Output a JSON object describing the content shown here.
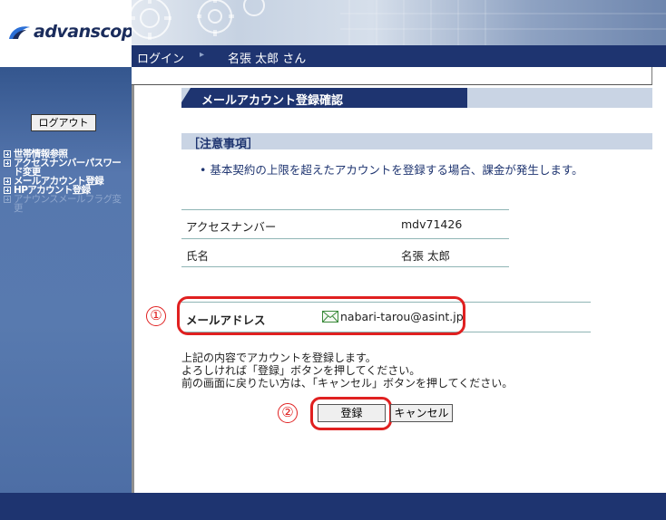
{
  "brand": {
    "logo_text": "advanscope"
  },
  "navbar": {
    "login": "ログイン",
    "separator": "▸",
    "user": "名張 太郎 さん"
  },
  "sidebar": {
    "logout_label": "ログアウト",
    "items": [
      {
        "label": "世帯情報参照",
        "enabled": true
      },
      {
        "label": "アクセスナンバーパスワード変更",
        "enabled": true
      },
      {
        "label": "メールアカウント登録",
        "enabled": true
      },
      {
        "label": "HPアカウント登録",
        "enabled": true
      },
      {
        "label": "アナウンスメールフラグ変更",
        "enabled": false
      }
    ]
  },
  "main": {
    "title": "メールアカウント登録確認",
    "notice_title": "［注意事項］",
    "notice_item": "• 基本契約の上限を超えたアカウントを登録する場合、課金が発生します。",
    "info": [
      {
        "label": "アクセスナンバー",
        "value": "mdv71426"
      },
      {
        "label": "氏名",
        "value": "名張 太郎"
      }
    ],
    "mail": {
      "label": "メールアドレス",
      "value": "nabari-tarou@asint.jp"
    },
    "message_lines": [
      "上記の内容でアカウントを登録します。",
      "よろしければ「登録」ボタンを押してください。",
      "前の画面に戻りたい方は、「キャンセル」ボタンを押してください。"
    ],
    "register_label": "登録",
    "cancel_label": "キャンセル"
  },
  "annotations": {
    "step1": "①",
    "step2": "②",
    "highlight_color": "#e02020"
  },
  "colors": {
    "navy": "#1e3470",
    "sidebar": "#5677ae",
    "band": "#c9d4e4"
  }
}
